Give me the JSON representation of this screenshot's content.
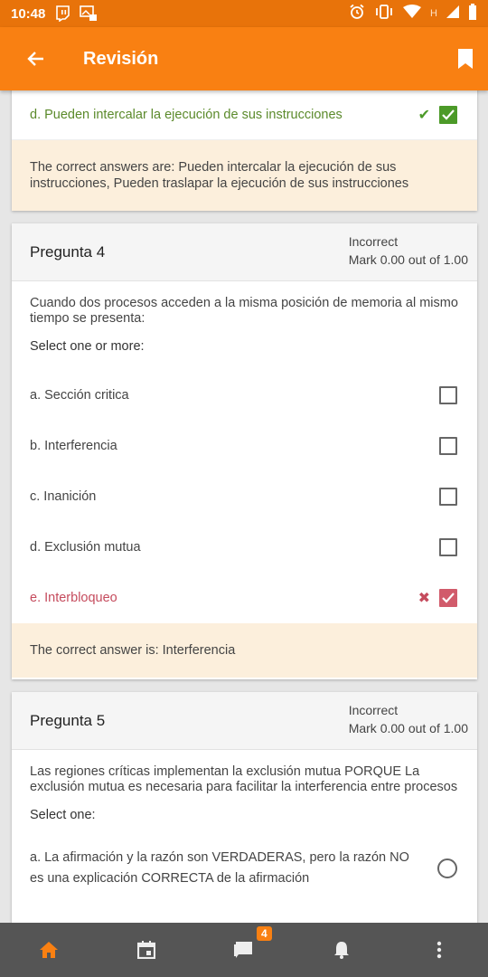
{
  "status": {
    "time": "10:48",
    "network_label": "H"
  },
  "appbar": {
    "title": "Revisión"
  },
  "q3_tail": {
    "option_d": "d. Pueden intercalar la ejecución de sus instrucciones",
    "feedback": "The correct answers are: Pueden intercalar la ejecución de sus instrucciones, Pueden traslapar la ejecución de sus instrucciones"
  },
  "q4": {
    "title": "Pregunta 4",
    "state": "Incorrect",
    "mark": "Mark 0.00 out of 1.00",
    "text": "Cuando dos procesos acceden a la misma posición de memoria al mismo tiempo se presenta:",
    "select": "Select one or more:",
    "options": [
      {
        "label": "a. Sección critica",
        "checked": false
      },
      {
        "label": "b. Interferencia",
        "checked": false
      },
      {
        "label": "c. Inanición",
        "checked": false
      },
      {
        "label": "d. Exclusión mutua",
        "checked": false
      },
      {
        "label": "e. Interbloqueo",
        "checked": true
      }
    ],
    "feedback": "The correct answer is: Interferencia"
  },
  "q5": {
    "title": "Pregunta 5",
    "state": "Incorrect",
    "mark": "Mark 0.00 out of 1.00",
    "text": "Las regiones críticas implementan la exclusión mutua PORQUE La exclusión mutua es necesaria para facilitar la interferencia entre procesos",
    "select": "Select one:",
    "option_a": "a. La afirmación y la razón son VERDADERAS, pero la razón NO es una explicación CORRECTA de la afirmación"
  },
  "bottom": {
    "messages_badge": "4"
  },
  "colors": {
    "accent": "#f98012",
    "correct": "#4c9a28",
    "incorrect": "#d15b6b",
    "feedback_bg": "#fcefdc"
  }
}
